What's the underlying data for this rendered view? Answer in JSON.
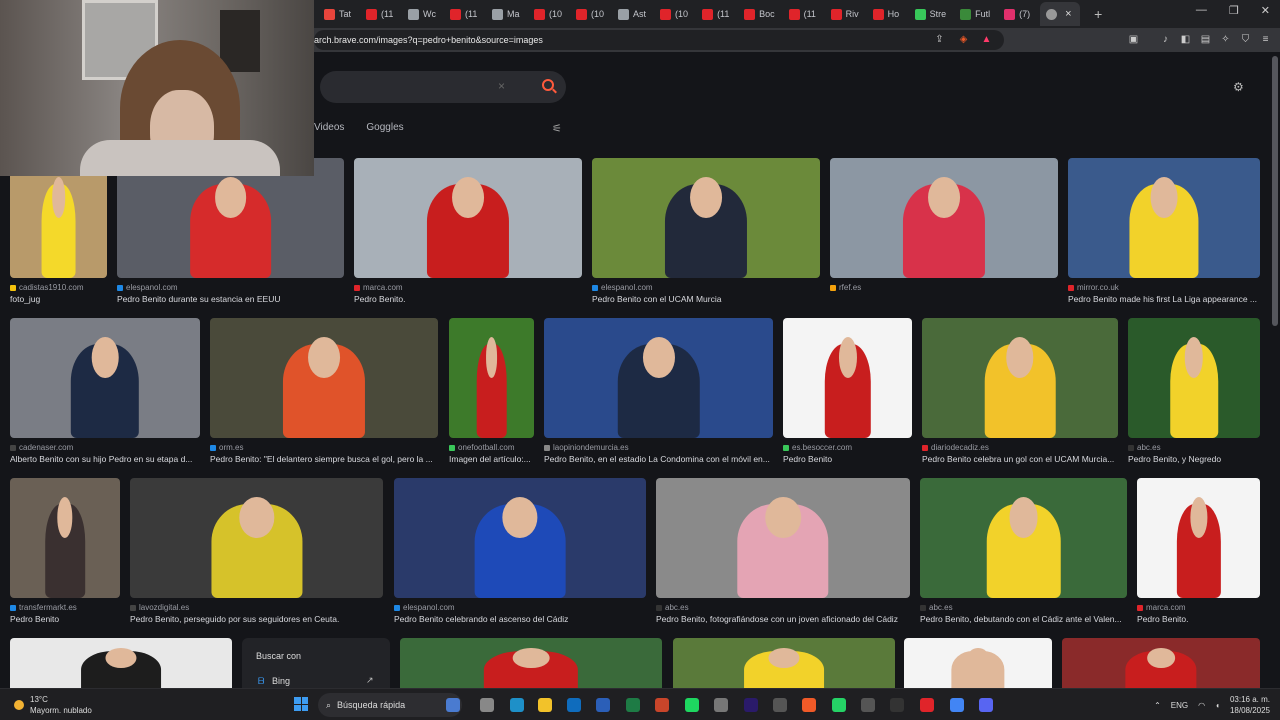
{
  "browser": {
    "tabs": [
      {
        "label": "Tat",
        "color": "#e8453c"
      },
      {
        "label": "(11",
        "color": "#e0242a"
      },
      {
        "label": "Wc",
        "color": "#9aa0a6"
      },
      {
        "label": "(11",
        "color": "#e0242a"
      },
      {
        "label": "Ma",
        "color": "#9aa0a6"
      },
      {
        "label": "(10",
        "color": "#e0242a"
      },
      {
        "label": "(10",
        "color": "#e0242a"
      },
      {
        "label": "Ast",
        "color": "#9aa0a6"
      },
      {
        "label": "(10",
        "color": "#e0242a"
      },
      {
        "label": "(11",
        "color": "#e0242a"
      },
      {
        "label": "Boc",
        "color": "#e0242a"
      },
      {
        "label": "(11",
        "color": "#e0242a"
      },
      {
        "label": "Riv",
        "color": "#e0242a"
      },
      {
        "label": "Ho",
        "color": "#e0242a"
      },
      {
        "label": "Stre",
        "color": "#38c75a"
      },
      {
        "label": "Futl",
        "color": "#3a8a3a"
      },
      {
        "label": "(7)",
        "color": "#e1306c"
      }
    ],
    "url": "arch.brave.com/images?q=pedro+benito&source=images"
  },
  "search": {
    "clear": "×"
  },
  "nav": {
    "videos": "Videos",
    "goggles": "Goggles"
  },
  "results": [
    {
      "src": "cadistas1910.com",
      "cap": "foto_jug",
      "sc": "#f4c20d",
      "bg": "#b89a6a",
      "fig": "#f4d92a"
    },
    {
      "src": "elespanol.com",
      "cap": "Pedro Benito durante su estancia en EEUU",
      "sc": "#1e88e5",
      "bg": "#5a5d66",
      "fig": "#d62b2b"
    },
    {
      "src": "marca.com",
      "cap": "Pedro Benito.",
      "sc": "#e0242a",
      "bg": "#a8b0b8",
      "fig": "#c81e1e"
    },
    {
      "src": "elespanol.com",
      "cap": "Pedro Benito con el UCAM Murcia",
      "sc": "#1e88e5",
      "bg": "#6b8a3a",
      "fig": "#22293a"
    },
    {
      "src": "rfef.es",
      "cap": "",
      "sc": "#f4a20d",
      "bg": "#8c97a3",
      "fig": "#d8324a"
    },
    {
      "src": "mirror.co.uk",
      "cap": "Pedro Benito made his first La Liga appearance ...",
      "sc": "#e0242a",
      "bg": "#3a5a8c",
      "fig": "#f2d22a"
    },
    {
      "src": "cadenaser.com",
      "cap": "Alberto Benito con su hijo Pedro en su etapa d...",
      "sc": "#444",
      "bg": "#7a7d85",
      "fig": "#1d2a44"
    },
    {
      "src": "orm.es",
      "cap": "Pedro Benito: \"El delantero siempre busca el gol, pero la ...",
      "sc": "#1e88e5",
      "bg": "#4a4a3a",
      "fig": "#e0532a"
    },
    {
      "src": "onefootball.com",
      "cap": "Imagen del artículo:...",
      "sc": "#3ac75a",
      "bg": "#3d7a2a",
      "fig": "#c81e1e"
    },
    {
      "src": "laopiniondemurcia.es",
      "cap": "Pedro Benito, en el estadio La Condomina con el móvil en...",
      "sc": "#888",
      "bg": "#2a4a8c",
      "fig": "#1d2a44"
    },
    {
      "src": "es.besoccer.com",
      "cap": "Pedro Benito",
      "sc": "#3ac75a",
      "bg": "#f4f4f4",
      "fig": "#c81e1e"
    },
    {
      "src": "diariodecadiz.es",
      "cap": "Pedro Benito celebra un gol con el UCAM Murcia...",
      "sc": "#e0242a",
      "bg": "#4a6a3a",
      "fig": "#f2c22a"
    },
    {
      "src": "abc.es",
      "cap": "Pedro Benito, y Negredo",
      "sc": "#333",
      "bg": "#2a5a2a",
      "fig": "#f2d22a"
    },
    {
      "src": "transfermarkt.es",
      "cap": "Pedro Benito",
      "sc": "#1e88e5",
      "bg": "#6a6055",
      "fig": "#3a3030"
    },
    {
      "src": "lavozdigital.es",
      "cap": "Pedro Benito, perseguido por sus seguidores en Ceuta.",
      "sc": "#444",
      "bg": "#3a3a3a",
      "fig": "#d6c22a"
    },
    {
      "src": "elespanol.com",
      "cap": "Pedro Benito celebrando el ascenso del Cádiz",
      "sc": "#1e88e5",
      "bg": "#2a3a6a",
      "fig": "#1e4ab8"
    },
    {
      "src": "abc.es",
      "cap": "Pedro Benito, fotografiándose con un joven aficionado del Cádiz",
      "sc": "#333",
      "bg": "#8a8a8a",
      "fig": "#e4a4b4"
    },
    {
      "src": "abc.es",
      "cap": "Pedro Benito, debutando con el Cádiz ante el Valen...",
      "sc": "#333",
      "bg": "#3a6a3a",
      "fig": "#f2d22a"
    },
    {
      "src": "marca.com",
      "cap": "Pedro Benito.",
      "sc": "#e0242a",
      "bg": "#f4f4f4",
      "fig": "#c81e1e"
    },
    {
      "src": "",
      "cap": "",
      "sc": "#444",
      "bg": "#e8e8e8",
      "fig": "#1d1d1d"
    },
    {
      "src": "",
      "cap": "",
      "sc": "#444",
      "bg": "#3a6a3a",
      "fig": "#c81e1e"
    },
    {
      "src": "",
      "cap": "",
      "sc": "#444",
      "bg": "#5a7a3a",
      "fig": "#f2d22a"
    },
    {
      "src": "",
      "cap": "",
      "sc": "#444",
      "bg": "#f4f4f4",
      "fig": "#e0b89a"
    },
    {
      "src": "",
      "cap": "",
      "sc": "#444",
      "bg": "#8a2a2a",
      "fig": "#c81e1e"
    }
  ],
  "popup": {
    "title": "Buscar con",
    "engine": "Bing"
  },
  "taskbar": {
    "temp": "13°C",
    "weather": "Mayorm. nublado",
    "search": "Búsqueda rápida",
    "lang": "ENG",
    "time": "03:16 a. m.",
    "date": "18/08/2025"
  }
}
